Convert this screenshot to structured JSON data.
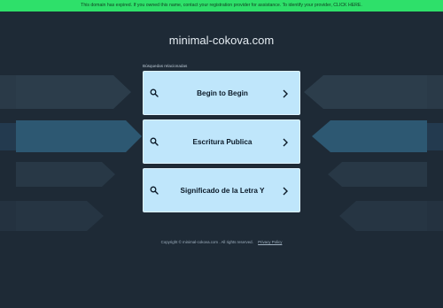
{
  "banner": {
    "text": "This domain has expired. If you owned this name, contact your registration provider for assistance. To identify your provider, CLICK HERE."
  },
  "site": {
    "domain": "minimal-cokova.com"
  },
  "related": {
    "label": "Búsquedas relacionadas",
    "items": [
      {
        "label": "Begin to Begin",
        "icon": "search-icon",
        "arrow": "chevron-right-icon"
      },
      {
        "label": "Escritura Publica",
        "icon": "search-icon",
        "arrow": "chevron-right-icon"
      },
      {
        "label": "Significado de la Letra Y",
        "icon": "search-icon",
        "arrow": "chevron-right-icon"
      }
    ]
  },
  "footer": {
    "copyright": "Copyright © minimal-cokova.com .  All rights reserved.",
    "privacy_label": "Privacy Policy"
  },
  "colors": {
    "background": "#1e2a36",
    "banner": "#2ee06a",
    "card": "#bfe6fb",
    "accent_shape": "#2d5872"
  }
}
